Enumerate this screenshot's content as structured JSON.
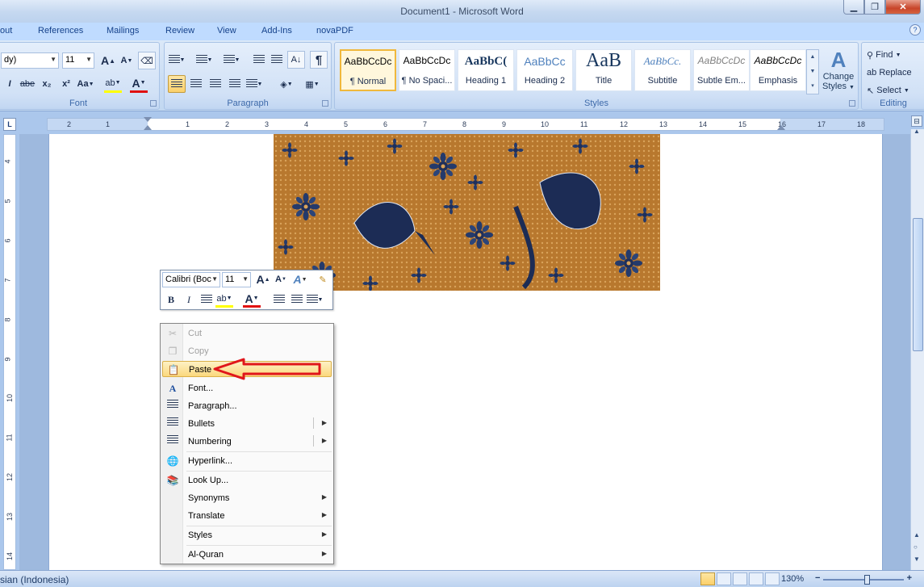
{
  "window": {
    "title": "Document1 - Microsoft Word",
    "minimize": "▁",
    "restore": "❐",
    "close": "✕"
  },
  "tabs": [
    "out",
    "References",
    "Mailings",
    "Review",
    "View",
    "Add-Ins",
    "novaPDF"
  ],
  "ribbon": {
    "font": {
      "name_value": "dy)",
      "size_value": "11",
      "grow_label": "A",
      "shrink_label": "A",
      "clear_label": "⌫",
      "underline_label": "I",
      "strike_label": "abe",
      "subscript_label": "x₂",
      "superscript_label": "x²",
      "case_label": "Aa",
      "highlight_label": "ab",
      "color_label": "A",
      "group_label": "Font"
    },
    "paragraph": {
      "show_marks_label": "¶",
      "sort_label": "A↓",
      "group_label": "Paragraph"
    },
    "styles": {
      "tiles": [
        {
          "sample": "AaBbCcDc",
          "name": "¶ Normal"
        },
        {
          "sample": "AaBbCcDc",
          "name": "¶ No Spaci..."
        },
        {
          "sample": "AaBbC(",
          "name": "Heading 1"
        },
        {
          "sample": "AaBbCc",
          "name": "Heading 2"
        },
        {
          "sample": "AaB",
          "name": "Title"
        },
        {
          "sample": "AaBbCc.",
          "name": "Subtitle"
        },
        {
          "sample": "AaBbCcDc",
          "name": "Subtle Em..."
        },
        {
          "sample": "AaBbCcDc",
          "name": "Emphasis"
        }
      ],
      "change_styles_line1": "Change",
      "change_styles_line2": "Styles",
      "group_label": "Styles"
    },
    "editing": {
      "find": "Find",
      "replace": "Replace",
      "select": "Select",
      "group_label": "Editing"
    }
  },
  "ruler": {
    "corner_label": "L",
    "ticks": [
      "2",
      "1",
      "1",
      "2",
      "3",
      "4",
      "5",
      "6",
      "7",
      "8",
      "9",
      "10",
      "11",
      "12",
      "13",
      "14",
      "15",
      "16",
      "17",
      "18"
    ],
    "vticks": [
      "4",
      "5",
      "6",
      "7",
      "8",
      "9",
      "10",
      "11",
      "12",
      "13",
      "14"
    ]
  },
  "minitoolbar": {
    "font_value": "Calibri (Boc",
    "size_value": "11",
    "grow": "A",
    "shrink": "A",
    "styles": "A",
    "bold": "B",
    "italic": "I",
    "highlight": "ab",
    "color": "A"
  },
  "context_menu": {
    "items": [
      {
        "label": "Cut",
        "icon": "scissors-icon",
        "enabled": false
      },
      {
        "label": "Copy",
        "icon": "copy-icon",
        "enabled": false
      },
      {
        "label": "Paste",
        "icon": "paste-icon",
        "enabled": true
      },
      {
        "label": "Font...",
        "icon": "font-icon",
        "enabled": true
      },
      {
        "label": "Paragraph...",
        "icon": "paragraph-icon",
        "enabled": true
      },
      {
        "label": "Bullets",
        "icon": "bullets-icon",
        "enabled": true
      },
      {
        "label": "Numbering",
        "icon": "numbering-icon",
        "enabled": true
      },
      {
        "label": "Hyperlink...",
        "icon": "hyperlink-icon",
        "enabled": true
      },
      {
        "label": "Look Up...",
        "icon": "research-icon",
        "enabled": true
      },
      {
        "label": "Synonyms",
        "enabled": true
      },
      {
        "label": "Translate",
        "enabled": true
      },
      {
        "label": "Styles",
        "enabled": true
      },
      {
        "label": "Al-Quran",
        "enabled": true
      }
    ]
  },
  "statusbar": {
    "language": "sian (Indonesia)",
    "zoom": "130%",
    "zoom_fraction": 0.55
  },
  "colors": {
    "accent": "#15428b",
    "highlight_yellow": "#fbd06b",
    "font_color_red": "#e01010",
    "arrow_red": "#e0161b"
  }
}
